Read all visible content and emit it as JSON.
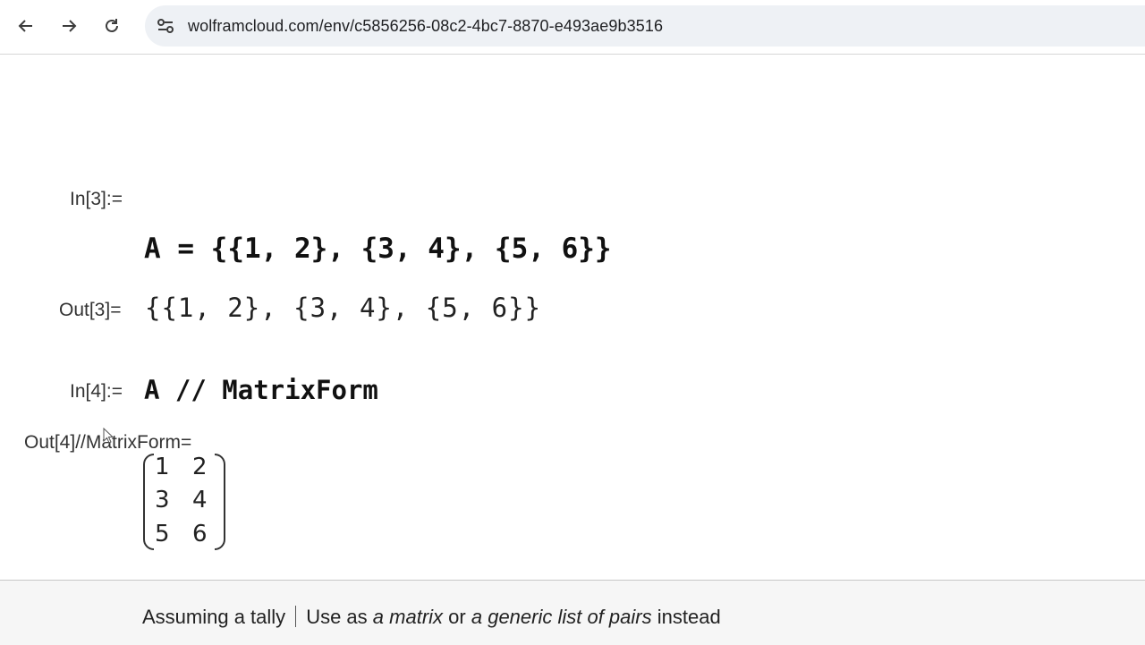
{
  "browser": {
    "url": "wolframcloud.com/env/c5856256-08c2-4bc7-8870-e493ae9b3516",
    "icons": [
      "back-arrow-icon",
      "forward-arrow-icon",
      "reload-icon",
      "site-settings-icon"
    ]
  },
  "notebook": {
    "cells": [
      {
        "in_label": "In[3]:=",
        "input": "A = {{1, 2}, {3, 4}, {5, 6}}",
        "out_label": "Out[3]=",
        "output": "{{1, 2}, {3, 4}, {5, 6}}"
      },
      {
        "in_label": "In[4]:=",
        "input": "A // MatrixForm",
        "out_label": "Out[4]//MatrixForm=",
        "matrix": [
          [
            "1",
            "2"
          ],
          [
            "3",
            "4"
          ],
          [
            "5",
            "6"
          ]
        ]
      }
    ]
  },
  "footer": {
    "assuming": "Assuming a tally",
    "use_as": "Use as",
    "option1": "a matrix",
    "or": "or",
    "option2": "a generic list of pairs",
    "instead": "instead"
  }
}
